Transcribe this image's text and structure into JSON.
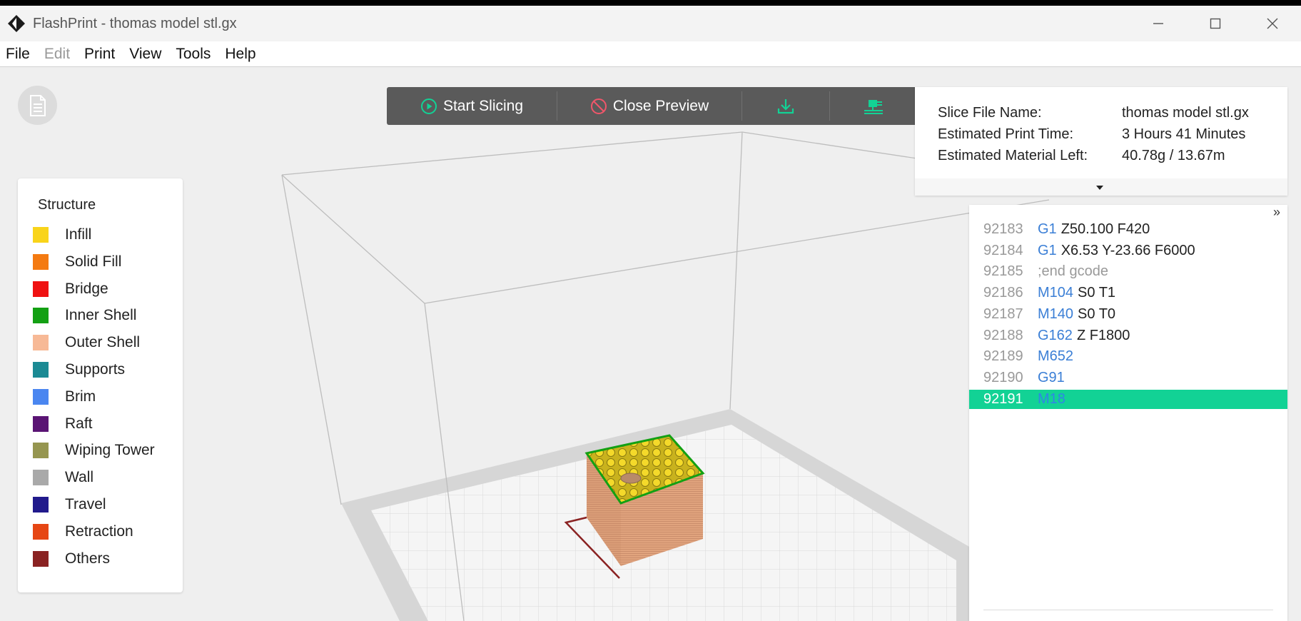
{
  "window": {
    "title": "FlashPrint - thomas model stl.gx"
  },
  "menu": [
    "File",
    "Edit",
    "Print",
    "View",
    "Tools",
    "Help"
  ],
  "menu_disabled": [
    "Edit"
  ],
  "toolbar": {
    "start_slicing": "Start Slicing",
    "close_preview": "Close Preview"
  },
  "info": {
    "slice_file_name_label": "Slice File Name:",
    "slice_file_name": "thomas model stl.gx",
    "print_time_label": "Estimated Print Time:",
    "print_time": "3 Hours 41 Minutes",
    "material_label": "Estimated Material Left:",
    "material": "40.78g / 13.67m"
  },
  "legend": {
    "title": "Structure",
    "items": [
      {
        "label": "Infill",
        "color": "#f9d41a"
      },
      {
        "label": "Solid Fill",
        "color": "#f47a11"
      },
      {
        "label": "Bridge",
        "color": "#ef1111"
      },
      {
        "label": "Inner Shell",
        "color": "#13a013"
      },
      {
        "label": "Outer Shell",
        "color": "#f7b996"
      },
      {
        "label": "Supports",
        "color": "#1b8a94"
      },
      {
        "label": "Brim",
        "color": "#4a86f0"
      },
      {
        "label": "Raft",
        "color": "#5a1474"
      },
      {
        "label": "Wiping Tower",
        "color": "#969650"
      },
      {
        "label": "Wall",
        "color": "#a9a9a9"
      },
      {
        "label": "Travel",
        "color": "#211a8c"
      },
      {
        "label": "Retraction",
        "color": "#e64614"
      },
      {
        "label": "Others",
        "color": "#8a2222"
      }
    ]
  },
  "gcode": {
    "lines": [
      {
        "num": "92183",
        "cmd": "G1",
        "args": "Z50.100 F420",
        "comment": false
      },
      {
        "num": "92184",
        "cmd": "G1",
        "args": "X6.53 Y-23.66 F6000",
        "comment": false
      },
      {
        "num": "92185",
        "cmd": ";end gcode",
        "args": "",
        "comment": true
      },
      {
        "num": "92186",
        "cmd": "M104",
        "args": "S0 T1",
        "comment": false
      },
      {
        "num": "92187",
        "cmd": "M140",
        "args": "S0 T0",
        "comment": false
      },
      {
        "num": "92188",
        "cmd": "G162",
        "args": "Z F1800",
        "comment": false
      },
      {
        "num": "92189",
        "cmd": "M652",
        "args": "",
        "comment": false
      },
      {
        "num": "92190",
        "cmd": "G91",
        "args": "",
        "comment": false
      },
      {
        "num": "92191",
        "cmd": "M18",
        "args": "",
        "comment": false
      }
    ],
    "active_line": "92191"
  },
  "colors": {
    "accent": "#12d295",
    "gcode_command": "#3b7fd6",
    "toolbar_bg": "#5a5a5a"
  }
}
